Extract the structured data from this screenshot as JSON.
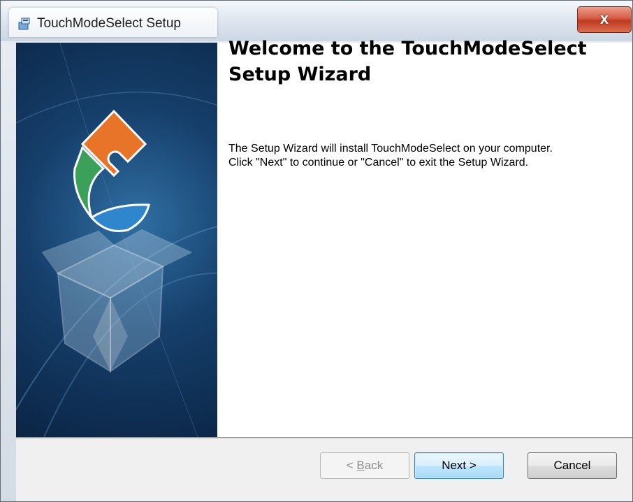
{
  "window": {
    "title": "TouchModeSelect Setup",
    "close_glyph": "x"
  },
  "icons": {
    "app": "installer-box-icon",
    "close": "close-icon"
  },
  "main": {
    "heading": "Welcome to the TouchModeSelect Setup Wizard",
    "description": "The Setup Wizard will install TouchModeSelect on your computer.  Click \"Next\" to continue or \"Cancel\" to exit the Setup Wizard."
  },
  "buttons": {
    "back_pre": "< ",
    "back_mnemonic": "B",
    "back_post": "ack",
    "back_enabled": false,
    "next": "Next >",
    "cancel": "Cancel"
  },
  "colors": {
    "banner": "#163f6b",
    "accent_next": "#3c7fb1",
    "puzzle_orange": "#e8742a",
    "puzzle_green": "#3aa05a",
    "puzzle_blue": "#2f86cc"
  }
}
